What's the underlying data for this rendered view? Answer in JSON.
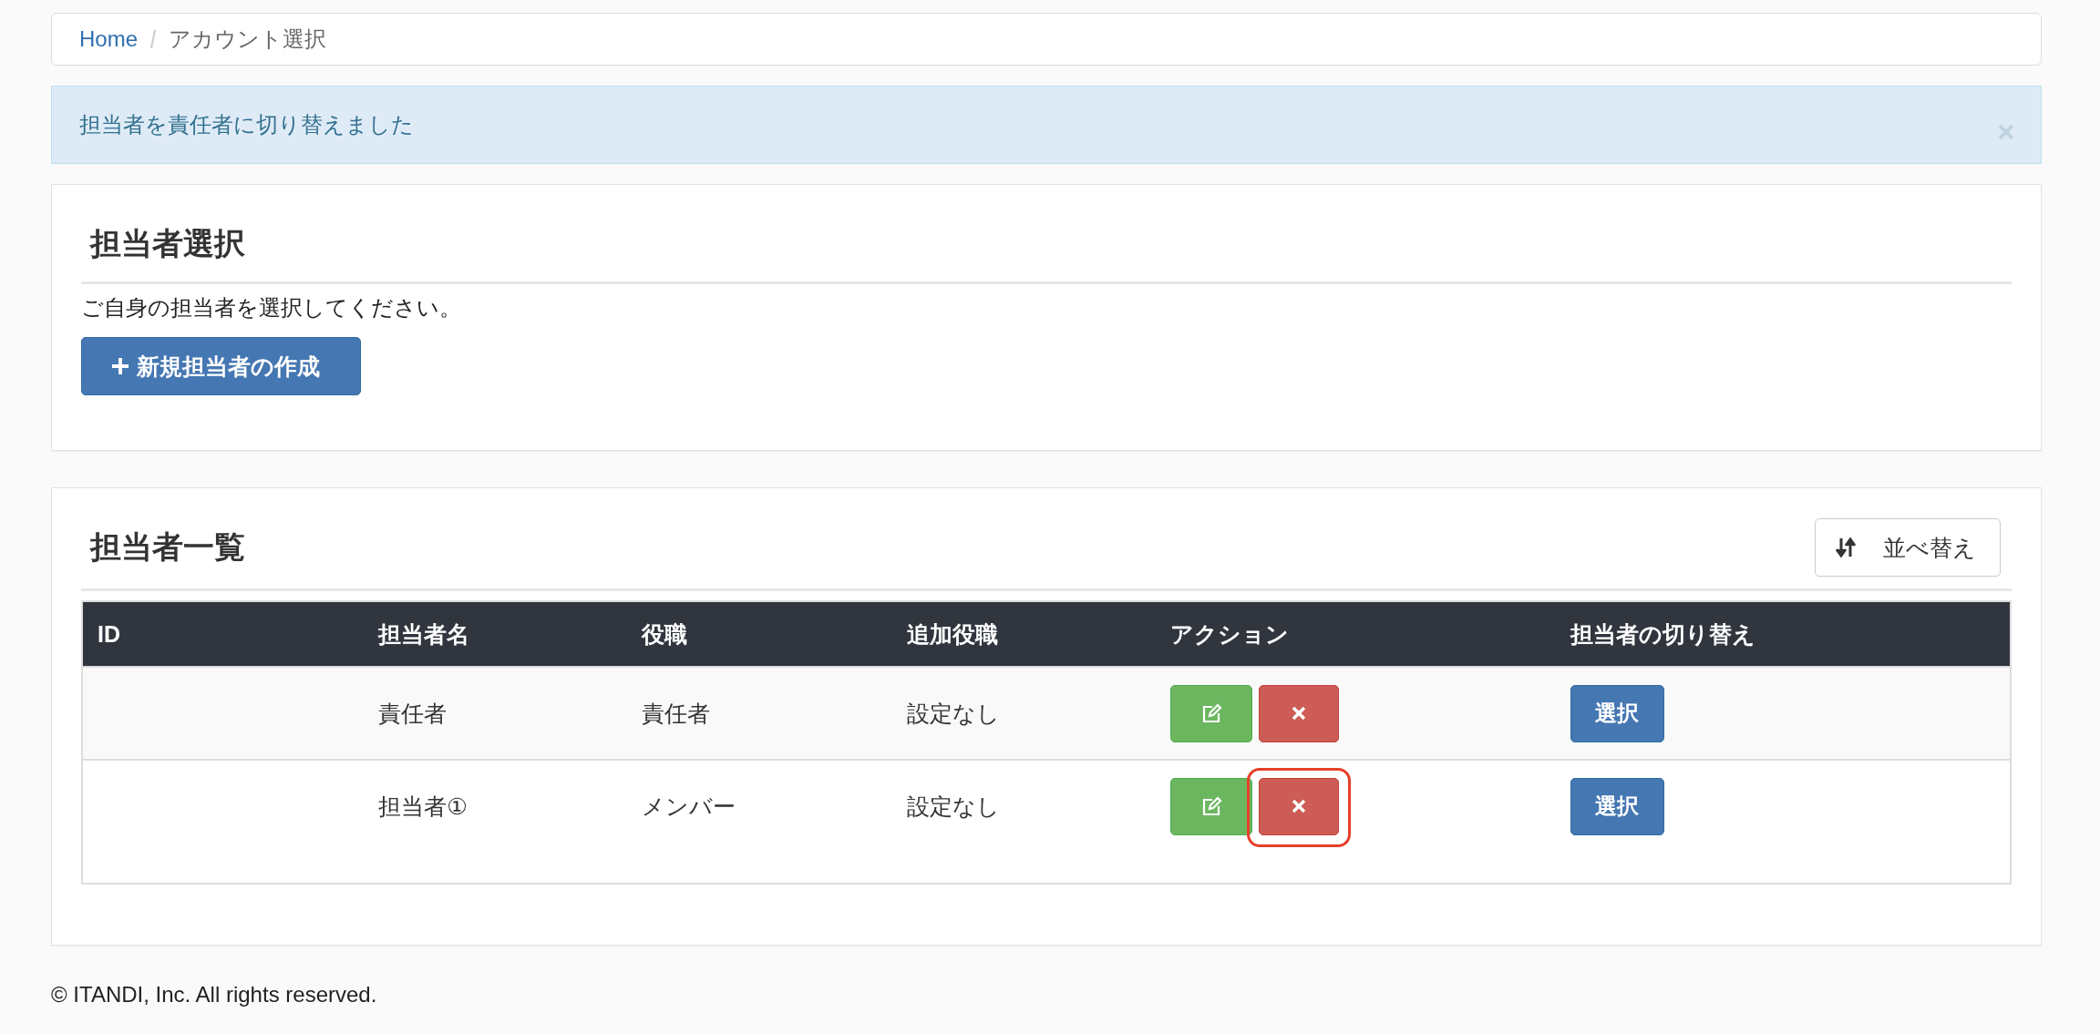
{
  "breadcrumb": [
    {
      "label": "Home",
      "kind": "link"
    },
    {
      "label": "アカウント選択",
      "kind": "current"
    }
  ],
  "alert": {
    "message": "担当者を責任者に切り替えました"
  },
  "select_panel": {
    "title": "担当者選択",
    "description": "ご自身の担当者を選択してください。",
    "create_button": "新規担当者の作成"
  },
  "list_panel": {
    "title": "担当者一覧",
    "sort_button": "並べ替え",
    "table": {
      "columns": [
        "ID",
        "担当者名",
        "役職",
        "追加役職",
        "アクション",
        "担当者の切り替え"
      ],
      "rows": [
        {
          "name": "責任者",
          "role": "責任者",
          "extra_role": "設定なし",
          "switch_button": "選択",
          "highlighted": false
        },
        {
          "name": "担当者①",
          "role": "メンバー",
          "extra_role": "設定なし",
          "switch_button": "選択",
          "highlighted": true
        }
      ]
    }
  },
  "footer": "© ITANDI, Inc. All rights reserved."
}
